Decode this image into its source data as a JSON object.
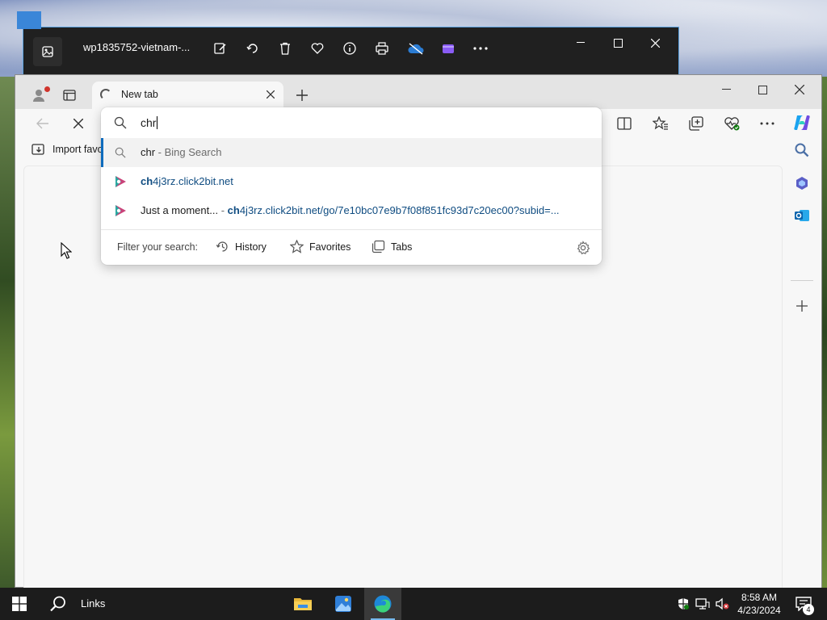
{
  "photos": {
    "filename": "wp1835752-vietnam-...",
    "tools": [
      "edit-icon",
      "rotate-icon",
      "delete-icon",
      "favorite-icon",
      "info-icon",
      "print-icon",
      "onedrive-icon",
      "clipchamp-icon",
      "more-icon"
    ]
  },
  "edge": {
    "tab_title": "New tab",
    "favorites_bar": {
      "import_label": "Import favo"
    },
    "omnibox": {
      "typed": "chr",
      "suggestions": [
        {
          "kind": "search",
          "query": "chr",
          "suffix": " - Bing Search"
        },
        {
          "kind": "site",
          "match": "ch",
          "rest": "4j3rz.click2bit.net"
        },
        {
          "kind": "history",
          "title": "Just a moment...",
          "sep": " - ",
          "match": "ch",
          "rest": "4j3rz.click2bit.net/go/7e10bc07e9b7f08f851fc93d7c20ec00?subid=..."
        }
      ],
      "filter_label": "Filter your search:",
      "filters": [
        "History",
        "Favorites",
        "Tabs"
      ]
    }
  },
  "taskbar": {
    "links_label": "Links",
    "time": "8:58 AM",
    "date": "4/23/2024",
    "notification_count": "4"
  },
  "colors": {
    "accent": "#0f6cbd",
    "taskbar": "#1c1c1c",
    "site_favicon": "#c9437a"
  }
}
